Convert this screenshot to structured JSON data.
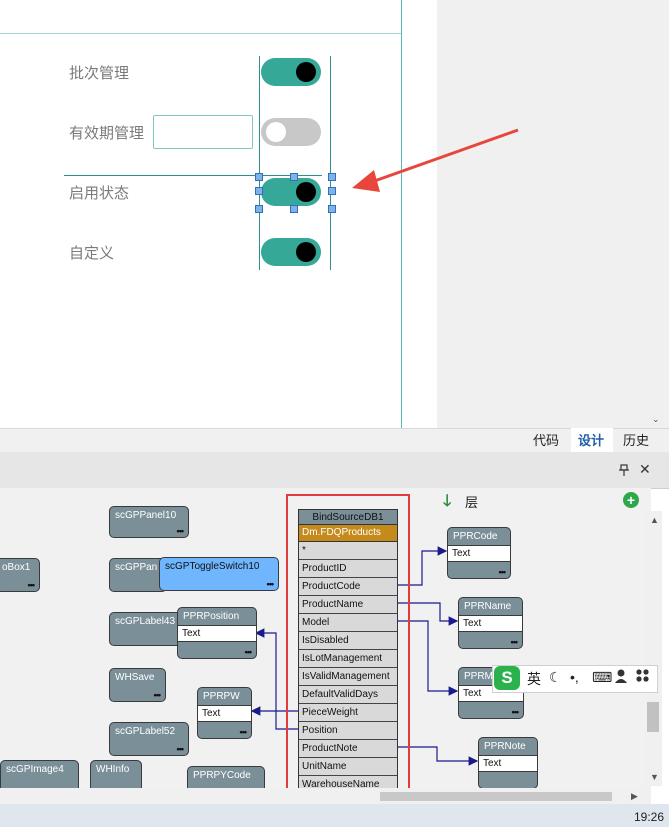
{
  "form": {
    "fields": [
      {
        "label": "批次管理",
        "toggle": "on"
      },
      {
        "label": "有效期管理",
        "toggle": "off"
      },
      {
        "label": "启用状态",
        "toggle": "on"
      },
      {
        "label": "自定义",
        "toggle": "on"
      }
    ]
  },
  "tabs": {
    "code": "代码",
    "design": "设计",
    "history": "历史"
  },
  "pane": {
    "pin_icon": "pin-icon",
    "close": "✕",
    "layer_label": "层",
    "add_icon": "plus-circle-icon"
  },
  "components": {
    "panel10": {
      "title": "scGPPanel10"
    },
    "combobox1": {
      "title": "oBox1"
    },
    "panel_trunc": {
      "title": "scGPPan"
    },
    "toggle_switch10": {
      "title": "scGPToggleSwitch10"
    },
    "label43": {
      "title": "scGPLabel43"
    },
    "ppr_position": {
      "title": "PPRPosition",
      "sub": "Text"
    },
    "whsave": {
      "title": "WHSave"
    },
    "pprpw": {
      "title": "PPRPW",
      "sub": "Text"
    },
    "label52": {
      "title": "scGPLabel52"
    },
    "image4": {
      "title": "scGPImage4"
    },
    "whinfo": {
      "title": "WHInfo"
    },
    "pprpycode": {
      "title": "PPRPYCode"
    },
    "pprcode": {
      "title": "PPRCode",
      "sub": "Text"
    },
    "pprname": {
      "title": "PPRName",
      "sub": "Text"
    },
    "pprm": {
      "title": "PPRM",
      "sub": "Text"
    },
    "pprnote": {
      "title": "PPRNote",
      "sub": "Text"
    }
  },
  "datasource": {
    "title": "BindSourceDB1",
    "dataset": "Dm.FDQProducts",
    "fields": [
      "*",
      "ProductID",
      "ProductCode",
      "ProductName",
      "Model",
      "IsDisabled",
      "IsLotManagement",
      "IsValidManagement",
      "DefaultValidDays",
      "PieceWeight",
      "Position",
      "ProductNote",
      "UnitName",
      "WarehouseName"
    ]
  },
  "ime": {
    "logo": "S",
    "lang": "英",
    "moon": "☾",
    "punct": "•,",
    "keyboard": "⌨",
    "user": "👤",
    "grid": "▦"
  },
  "taskbar": {
    "time": "19:26"
  },
  "dots": "•••"
}
